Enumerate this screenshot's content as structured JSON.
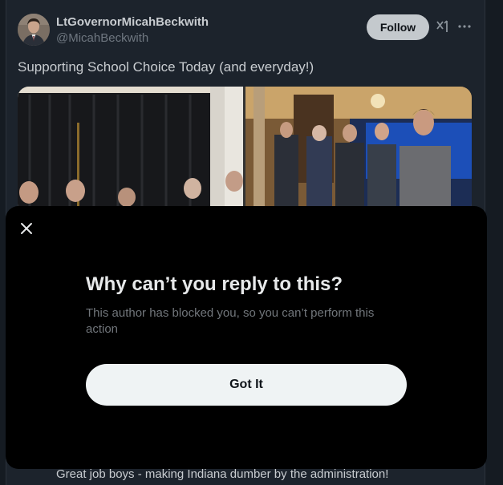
{
  "tweet": {
    "display_name": "LtGovernorMicahBeckwith",
    "handle": "@MicahBeckwith",
    "follow_label": "Follow",
    "text": "Supporting School Choice Today (and everyday!)",
    "icons": [
      "grok-icon",
      "more-icon"
    ]
  },
  "reply_preview": {
    "text": "Great job boys - making Indiana dumber by the administration!"
  },
  "modal": {
    "close_icon": "close-icon",
    "title": "Why can’t you reply to this?",
    "body": "This author has blocked you, so you can’t perform this action",
    "button_label": "Got It"
  },
  "colors": {
    "modal_bg": "#000000",
    "follow_bg": "#c4c9cd",
    "button_bg": "#eff3f4",
    "page_bg": "#1c232c"
  }
}
